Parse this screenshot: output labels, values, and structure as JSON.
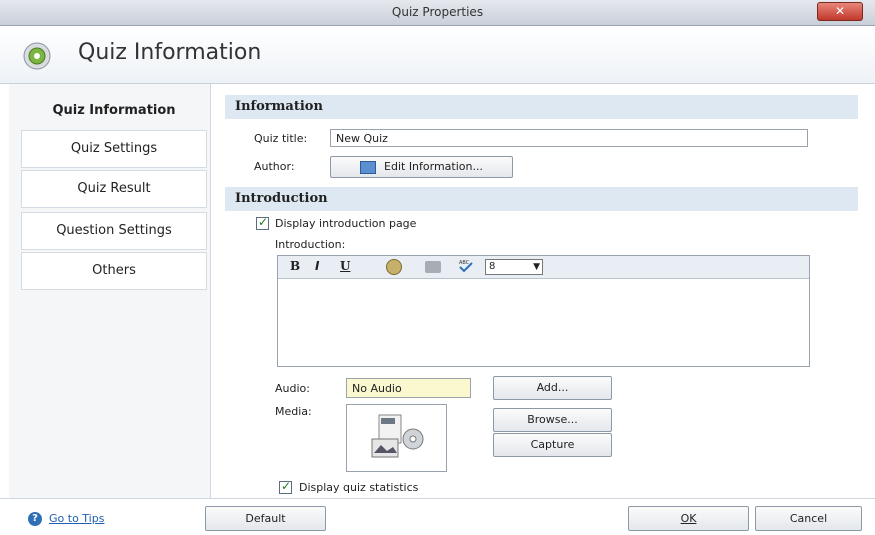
{
  "window": {
    "title": "Quiz Properties",
    "close_glyph": "✕"
  },
  "header": {
    "title": "Quiz Information",
    "icon": "gear-icon"
  },
  "sidebar": {
    "items": [
      {
        "label": "Quiz Information",
        "active": true
      },
      {
        "label": "Quiz Settings"
      },
      {
        "label": "Quiz Result"
      },
      {
        "label": "Question Settings"
      },
      {
        "label": "Others"
      }
    ]
  },
  "information": {
    "heading": "Information",
    "quiz_title_label": "Quiz title:",
    "quiz_title_value": "New Quiz",
    "author_label": "Author:",
    "edit_info_button": "Edit Information..."
  },
  "introduction": {
    "heading": "Introduction",
    "display_checkbox_label": "Display introduction page",
    "display_checked": true,
    "intro_label": "Introduction:",
    "toolbar": {
      "bold": "B",
      "italic": "I",
      "underline": "U",
      "font_size": "8"
    },
    "content": ""
  },
  "audio": {
    "label": "Audio:",
    "value": "No Audio",
    "add_button": "Add..."
  },
  "media": {
    "label": "Media:",
    "browse_button": "Browse...",
    "capture_button": "Capture"
  },
  "statistics": {
    "checkbox_label": "Display quiz statistics",
    "checked": true
  },
  "footer": {
    "tips_link": "Go to Tips",
    "default_button": "Default",
    "ok_button": "OK",
    "cancel_button": "Cancel"
  }
}
